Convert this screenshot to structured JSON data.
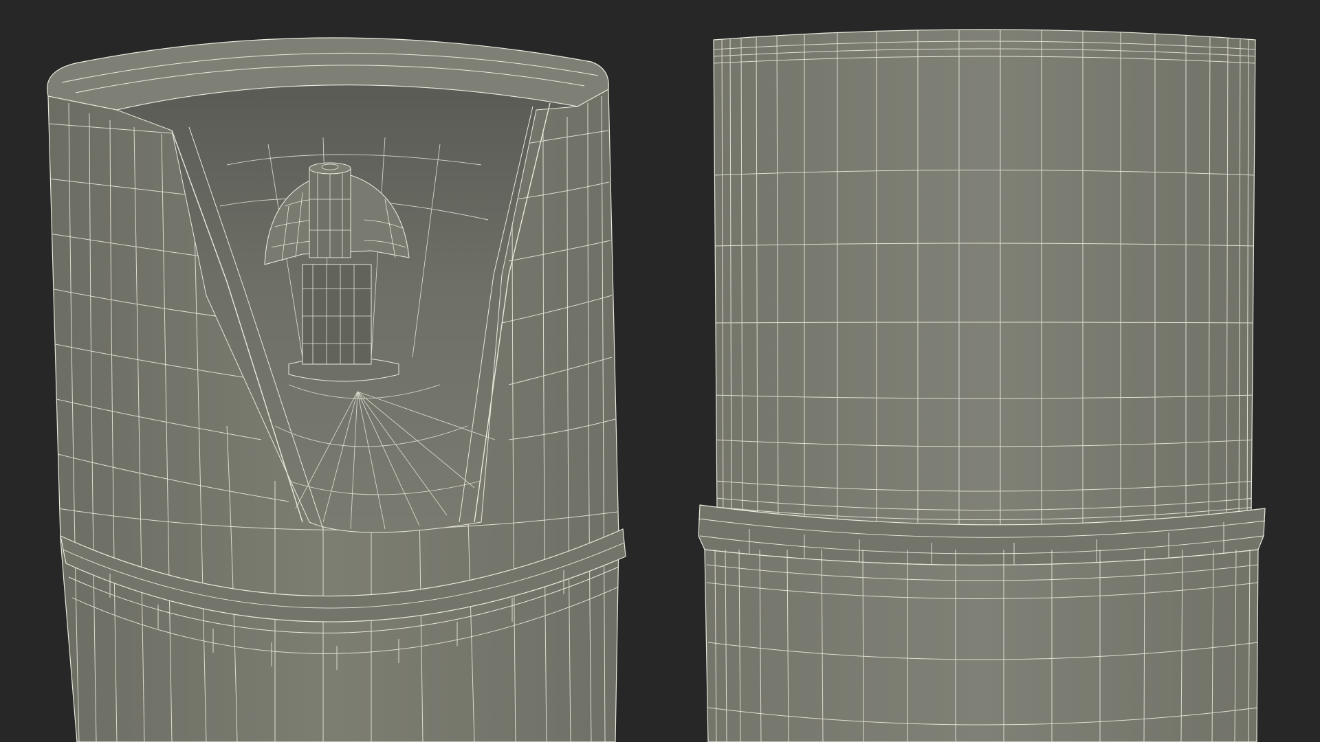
{
  "scene": {
    "background": "#272727",
    "surface": "#7a7b6f",
    "surface_dark": "#5f6058",
    "surface_shadow": "#4f504a",
    "wire": "#e9e9de",
    "objects": [
      {
        "name": "cut-cylinder-with-v-notch-and-stem"
      },
      {
        "name": "solid-cylinder-with-collar"
      }
    ]
  }
}
